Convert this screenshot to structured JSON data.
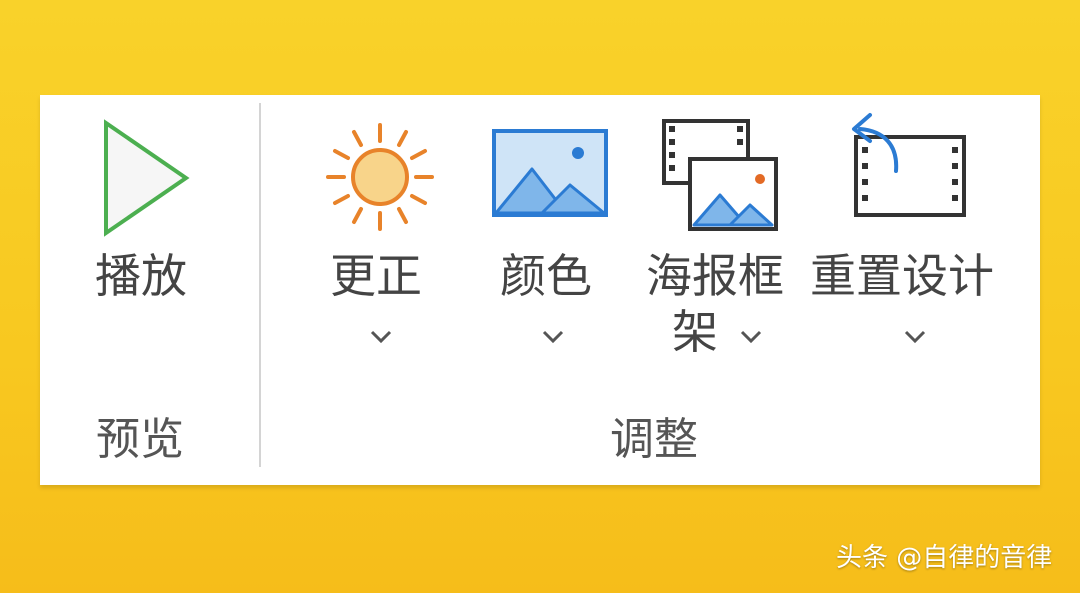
{
  "ribbon": {
    "groups": [
      {
        "label": "预览",
        "commands": [
          {
            "label": "播放",
            "icon": "play-icon",
            "has_dropdown": false
          }
        ]
      },
      {
        "label": "调整",
        "commands": [
          {
            "label": "更正",
            "icon": "sun-icon",
            "has_dropdown": true
          },
          {
            "label": "颜色",
            "icon": "picture-icon",
            "has_dropdown": true
          },
          {
            "label_line1": "海报框",
            "label_line2": "架",
            "icon": "poster-frame-icon",
            "has_dropdown": true
          },
          {
            "label": "重置设计",
            "icon": "reset-design-icon",
            "has_dropdown": true
          }
        ]
      }
    ]
  },
  "colors": {
    "background": "#f8c820",
    "panel": "#ffffff",
    "text": "#444444",
    "play_green": "#4caf50",
    "sun_orange": "#e8832a",
    "sun_fill": "#f8d48a",
    "picture_blue": "#2b7bd3",
    "picture_fill": "#a9cff0",
    "frame_dot": "#e36a25"
  },
  "watermark": "头条 @自律的音律"
}
